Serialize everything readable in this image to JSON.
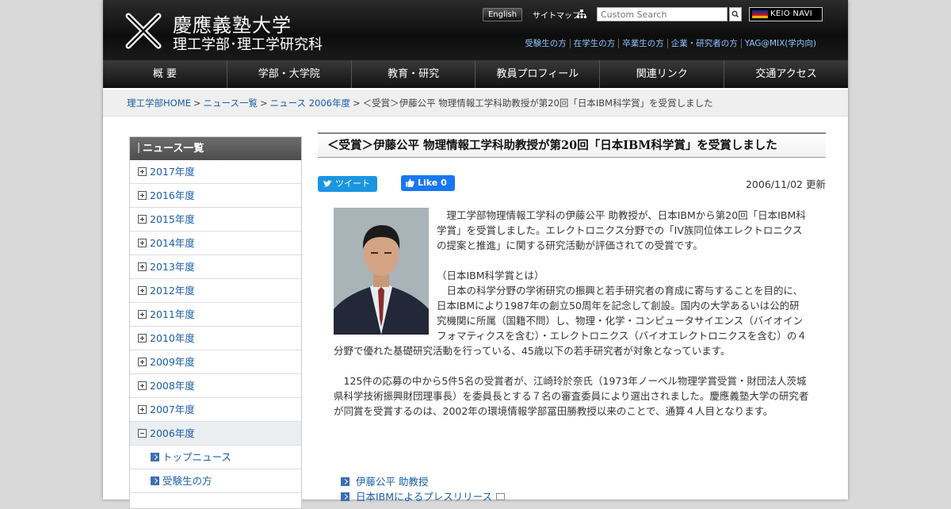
{
  "header": {
    "logo_name": "慶應義塾大学",
    "logo_sub": "理工学部･理工学研究科",
    "english_label": "English",
    "sitemap_label": "サイトマップ",
    "search_placeholder": "Custom Search",
    "keio_navi_label": "KEIO NAVI",
    "audience_links": [
      "受験生の方",
      "在学生の方",
      "卒業生の方",
      "企業・研究者の方",
      "YAG@MIX(学内向)"
    ]
  },
  "mainnav": [
    "概 要",
    "学部・大学院",
    "教育・研究",
    "教員プロフィール",
    "関連リンク",
    "交通アクセス"
  ],
  "breadcrumb": {
    "items": [
      "理工学部HOME",
      "ニュース一覧",
      "ニュース 2006年度"
    ],
    "separator": ">",
    "current": "＜受賞＞伊藤公平 物理情報工学科助教授が第20回「日本IBM科学賞」を受賞しました"
  },
  "sidebar": {
    "title": "ニュース一覧",
    "years": [
      "2017年度",
      "2016年度",
      "2015年度",
      "2014年度",
      "2013年度",
      "2012年度",
      "2011年度",
      "2010年度",
      "2009年度",
      "2008年度",
      "2007年度"
    ],
    "active_year": "2006年度",
    "sub_items": [
      "トップニュース",
      "受験生の方"
    ]
  },
  "article": {
    "title": "＜受賞＞伊藤公平 物理情報工学科助教授が第20回「日本IBM科学賞」を受賞しました",
    "tweet_label": "ツイート",
    "like_label": "Like 0",
    "updated": "2006/11/02 更新",
    "para1": "　理工学部物理情報工学科の伊藤公平 助教授が、日本IBMから第20回「日本IBM科学賞」を受賞しました。エレクトロニクス分野での「IV族同位体エレクトロニクスの提案と推進」に関する研究活動が評価されての受賞です。",
    "para2_heading": "（日本IBM科学賞とは）",
    "para2": "　日本の科学分野の学術研究の振興と若手研究者の育成に寄与することを目的に、日本IBMにより1987年の創立50周年を記念して創設。国内の大学あるいは公的研究機関に所属（国籍不問）し、物理・化学・コンピュータサイエンス（バイオインフォマティクスを含む）・エレクトロニクス（バイオエレクトロニクスを含む）の４分野で優れた基礎研究活動を行っている、45歳以下の若手研究者が対象となっています。",
    "para3": "　125件の応募の中から5件5名の受賞者が、江崎玲於奈氏（1973年ノーベル物理学賞受賞・財団法人茨城県科学技術振興財団理事長）を委員長とする７名の審査委員により選出されました。慶應義塾大学の研究者が同賞を受賞するのは、2002年の環境情報学部冨田勝教授以来のことで、通算４人目となります。",
    "related_links": [
      "伊藤公平 助教授",
      "日本IBMによるプレスリリース"
    ]
  },
  "colors": {
    "link": "#1a5ca8",
    "audience_link": "#8ec7ff",
    "header_bg": "#111111",
    "tweet": "#1b95e0",
    "like": "#1877f2"
  }
}
